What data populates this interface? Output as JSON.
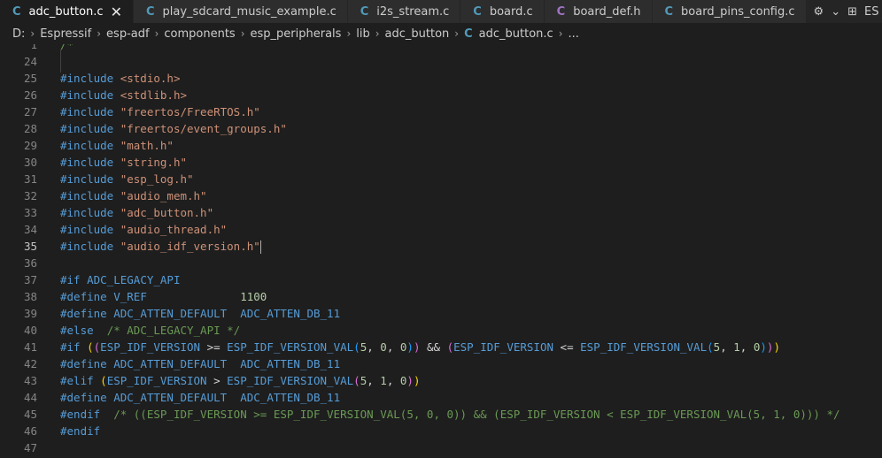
{
  "tabs": [
    {
      "label": "adc_button.c",
      "icon": "C",
      "type": "c",
      "active": true
    },
    {
      "label": "play_sdcard_music_example.c",
      "icon": "C",
      "type": "c"
    },
    {
      "label": "i2s_stream.c",
      "icon": "C",
      "type": "c"
    },
    {
      "label": "board.c",
      "icon": "C",
      "type": "c"
    },
    {
      "label": "board_def.h",
      "icon": "C",
      "type": "h"
    },
    {
      "label": "board_pins_config.c",
      "icon": "C",
      "type": "c"
    }
  ],
  "tab_close_glyph": "✕",
  "tab_actions": {
    "run_glyph": "⚙",
    "chevron": "⌄",
    "split_glyph": "⊞",
    "overflow": "ES"
  },
  "breadcrumb": {
    "items": [
      "D:",
      "Espressif",
      "esp-adf",
      "components",
      "esp_peripherals",
      "lib",
      "adc_button"
    ],
    "file_icon": "C",
    "file": "adc_button.c",
    "tail": "..."
  },
  "lines": [
    {
      "n": "1",
      "tokens": [
        {
          "t": "/*",
          "c": "cmt"
        }
      ],
      "partial": true
    },
    {
      "n": "24",
      "tokens": []
    },
    {
      "n": "25",
      "tokens": [
        {
          "t": "#include ",
          "c": "kw"
        },
        {
          "t": "<stdio.h>",
          "c": "str"
        }
      ]
    },
    {
      "n": "26",
      "tokens": [
        {
          "t": "#include ",
          "c": "kw"
        },
        {
          "t": "<stdlib.h>",
          "c": "str"
        }
      ]
    },
    {
      "n": "27",
      "tokens": [
        {
          "t": "#include ",
          "c": "kw"
        },
        {
          "t": "\"freertos/FreeRTOS.h\"",
          "c": "str"
        }
      ]
    },
    {
      "n": "28",
      "tokens": [
        {
          "t": "#include ",
          "c": "kw"
        },
        {
          "t": "\"freertos/event_groups.h\"",
          "c": "str"
        }
      ]
    },
    {
      "n": "29",
      "tokens": [
        {
          "t": "#include ",
          "c": "kw"
        },
        {
          "t": "\"math.h\"",
          "c": "str"
        }
      ]
    },
    {
      "n": "30",
      "tokens": [
        {
          "t": "#include ",
          "c": "kw"
        },
        {
          "t": "\"string.h\"",
          "c": "str"
        }
      ]
    },
    {
      "n": "31",
      "tokens": [
        {
          "t": "#include ",
          "c": "kw"
        },
        {
          "t": "\"esp_log.h\"",
          "c": "str"
        }
      ]
    },
    {
      "n": "32",
      "tokens": [
        {
          "t": "#include ",
          "c": "kw"
        },
        {
          "t": "\"audio_mem.h\"",
          "c": "str"
        }
      ]
    },
    {
      "n": "33",
      "tokens": [
        {
          "t": "#include ",
          "c": "kw"
        },
        {
          "t": "\"adc_button.h\"",
          "c": "str"
        }
      ]
    },
    {
      "n": "34",
      "tokens": [
        {
          "t": "#include ",
          "c": "kw"
        },
        {
          "t": "\"audio_thread.h\"",
          "c": "str"
        }
      ]
    },
    {
      "n": "35",
      "tokens": [
        {
          "t": "#include ",
          "c": "kw"
        },
        {
          "t": "\"audio_idf_version.h\"",
          "c": "str"
        }
      ],
      "current": true,
      "cursor": true
    },
    {
      "n": "36",
      "tokens": []
    },
    {
      "n": "37",
      "tokens": [
        {
          "t": "#if ",
          "c": "kw"
        },
        {
          "t": "ADC_LEGACY_API",
          "c": "mac"
        }
      ]
    },
    {
      "n": "38",
      "tokens": [
        {
          "t": "#define ",
          "c": "kw"
        },
        {
          "t": "V_REF",
          "c": "mac"
        },
        {
          "t": "              ",
          "c": "code"
        },
        {
          "t": "1100",
          "c": "num"
        }
      ]
    },
    {
      "n": "39",
      "tokens": [
        {
          "t": "#define ",
          "c": "kw"
        },
        {
          "t": "ADC_ATTEN_DEFAULT",
          "c": "mac"
        },
        {
          "t": "  ",
          "c": "code"
        },
        {
          "t": "ADC_ATTEN_DB_11",
          "c": "mac"
        }
      ]
    },
    {
      "n": "40",
      "tokens": [
        {
          "t": "#else",
          "c": "kw"
        },
        {
          "t": "  /* ADC_LEGACY_API */",
          "c": "cmt"
        }
      ]
    },
    {
      "n": "41",
      "tokens": [
        {
          "t": "#if ",
          "c": "kw"
        },
        {
          "t": "(",
          "c": "p1"
        },
        {
          "t": "(",
          "c": "p2"
        },
        {
          "t": "ESP_IDF_VERSION",
          "c": "mac"
        },
        {
          "t": " >= ",
          "c": "code"
        },
        {
          "t": "ESP_IDF_VERSION_VAL",
          "c": "mac"
        },
        {
          "t": "(",
          "c": "p3"
        },
        {
          "t": "5",
          "c": "num"
        },
        {
          "t": ", ",
          "c": "code"
        },
        {
          "t": "0",
          "c": "num"
        },
        {
          "t": ", ",
          "c": "code"
        },
        {
          "t": "0",
          "c": "num"
        },
        {
          "t": ")",
          "c": "p3"
        },
        {
          "t": ")",
          "c": "p2"
        },
        {
          "t": " && ",
          "c": "code"
        },
        {
          "t": "(",
          "c": "p2"
        },
        {
          "t": "ESP_IDF_VERSION",
          "c": "mac"
        },
        {
          "t": " <= ",
          "c": "code"
        },
        {
          "t": "ESP_IDF_VERSION_VAL",
          "c": "mac"
        },
        {
          "t": "(",
          "c": "p3"
        },
        {
          "t": "5",
          "c": "num"
        },
        {
          "t": ", ",
          "c": "code"
        },
        {
          "t": "1",
          "c": "num"
        },
        {
          "t": ", ",
          "c": "code"
        },
        {
          "t": "0",
          "c": "num"
        },
        {
          "t": ")",
          "c": "p3"
        },
        {
          "t": ")",
          "c": "p2"
        },
        {
          "t": ")",
          "c": "p1"
        }
      ]
    },
    {
      "n": "42",
      "tokens": [
        {
          "t": "#define ",
          "c": "kw"
        },
        {
          "t": "ADC_ATTEN_DEFAULT",
          "c": "mac"
        },
        {
          "t": "  ",
          "c": "code"
        },
        {
          "t": "ADC_ATTEN_DB_11",
          "c": "mac"
        }
      ]
    },
    {
      "n": "43",
      "tokens": [
        {
          "t": "#elif ",
          "c": "kw"
        },
        {
          "t": "(",
          "c": "p1"
        },
        {
          "t": "ESP_IDF_VERSION",
          "c": "mac"
        },
        {
          "t": " > ",
          "c": "code"
        },
        {
          "t": "ESP_IDF_VERSION_VAL",
          "c": "mac"
        },
        {
          "t": "(",
          "c": "p2"
        },
        {
          "t": "5",
          "c": "num"
        },
        {
          "t": ", ",
          "c": "code"
        },
        {
          "t": "1",
          "c": "num"
        },
        {
          "t": ", ",
          "c": "code"
        },
        {
          "t": "0",
          "c": "num"
        },
        {
          "t": ")",
          "c": "p2"
        },
        {
          "t": ")",
          "c": "p1"
        }
      ]
    },
    {
      "n": "44",
      "tokens": [
        {
          "t": "#define ",
          "c": "kw"
        },
        {
          "t": "ADC_ATTEN_DEFAULT",
          "c": "mac"
        },
        {
          "t": "  ",
          "c": "code"
        },
        {
          "t": "ADC_ATTEN_DB_11",
          "c": "mac"
        }
      ]
    },
    {
      "n": "45",
      "tokens": [
        {
          "t": "#endif",
          "c": "kw"
        },
        {
          "t": "  /* ((ESP_IDF_VERSION >= ESP_IDF_VERSION_VAL(5, 0, 0)) && (ESP_IDF_VERSION < ESP_IDF_VERSION_VAL(5, 1, 0))) */",
          "c": "cmt"
        }
      ]
    },
    {
      "n": "46",
      "tokens": [
        {
          "t": "#endif",
          "c": "kw"
        }
      ]
    },
    {
      "n": "47",
      "tokens": []
    }
  ]
}
